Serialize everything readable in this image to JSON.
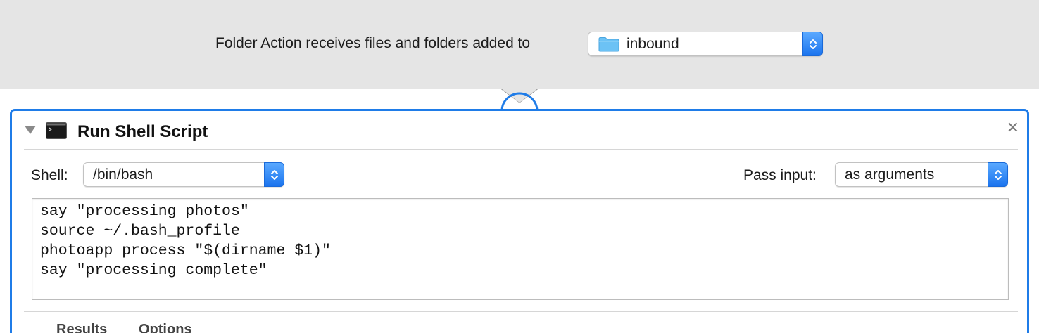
{
  "workflow_header": {
    "receives_label": "Folder Action receives files and folders added to",
    "folder_popup": {
      "value": "inbound",
      "icon": "folder-icon"
    }
  },
  "action": {
    "title": "Run Shell Script",
    "icon": "terminal-icon",
    "shell": {
      "label": "Shell:",
      "value": "/bin/bash"
    },
    "pass_input": {
      "label": "Pass input:",
      "value": "as arguments"
    },
    "script_lines": [
      "say \"processing photos\"",
      "source ~/.bash_profile",
      "photoapp process \"$(dirname $1)\"",
      "say \"processing complete\""
    ],
    "footer_tabs": [
      "Results",
      "Options"
    ]
  },
  "colors": {
    "accent": "#1f7ce8",
    "header_bg": "#e5e5e5",
    "folder": "#6cc2f5"
  }
}
